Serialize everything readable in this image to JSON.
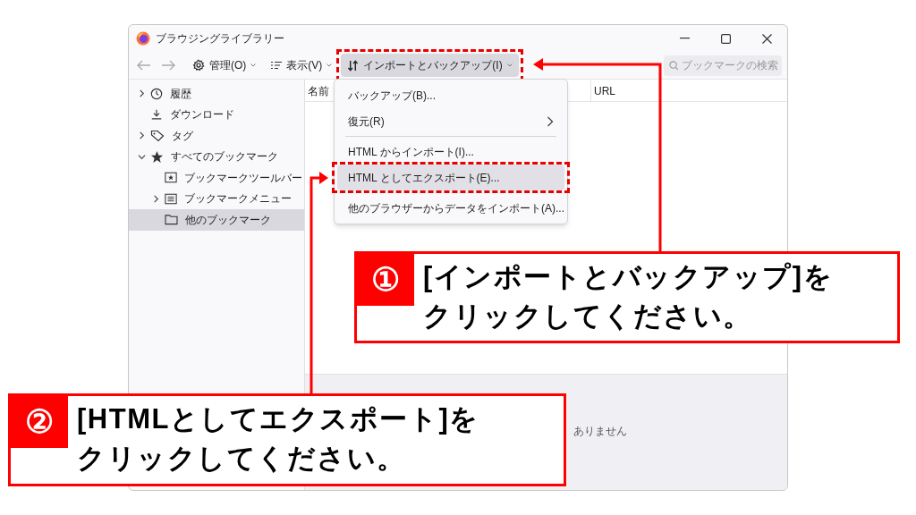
{
  "window": {
    "title": "ブラウジングライブラリー"
  },
  "toolbar": {
    "buttons": [
      {
        "label": "管理(O)",
        "open": false
      },
      {
        "label": "表示(V)",
        "open": false
      },
      {
        "label": "インポートとバックアップ(I)",
        "open": true
      }
    ],
    "search": {
      "placeholder": "ブックマークの検索"
    }
  },
  "sidebar": {
    "items": [
      {
        "label": "履歴",
        "expanded": false,
        "selected": false
      },
      {
        "label": "ダウンロード",
        "selected": false
      },
      {
        "label": "タグ",
        "expanded": false,
        "selected": false
      },
      {
        "label": "すべてのブックマーク",
        "expanded": true,
        "selected": false,
        "children": [
          {
            "label": "ブックマークツールバー",
            "selected": false
          },
          {
            "label": "ブックマークメニュー",
            "expanded": false,
            "selected": false
          },
          {
            "label": "他のブックマーク",
            "selected": true
          }
        ]
      }
    ]
  },
  "table": {
    "columns": [
      "名前",
      "URL"
    ]
  },
  "menu": {
    "items": [
      {
        "kind": "item",
        "label": "バックアップ(B)...",
        "highlighted": false
      },
      {
        "kind": "submenu",
        "label": "復元(R)",
        "highlighted": false
      },
      {
        "kind": "separator"
      },
      {
        "kind": "item",
        "label": "HTML からインポート(I)...",
        "highlighted": false
      },
      {
        "kind": "item",
        "label": "HTML としてエクスポート(E)...",
        "highlighted": true
      },
      {
        "kind": "item",
        "label": "他のブラウザーからデータをインポート(A)...",
        "highlighted": false
      }
    ]
  },
  "details": {
    "text": "ありません"
  },
  "callouts": [
    {
      "number": "①",
      "lines": [
        "[インポートとバックアップ]を",
        "クリックしてください。"
      ]
    },
    {
      "number": "②",
      "lines": [
        "[HTMLとしてエクスポート]を",
        "クリックしてください。"
      ]
    }
  ]
}
